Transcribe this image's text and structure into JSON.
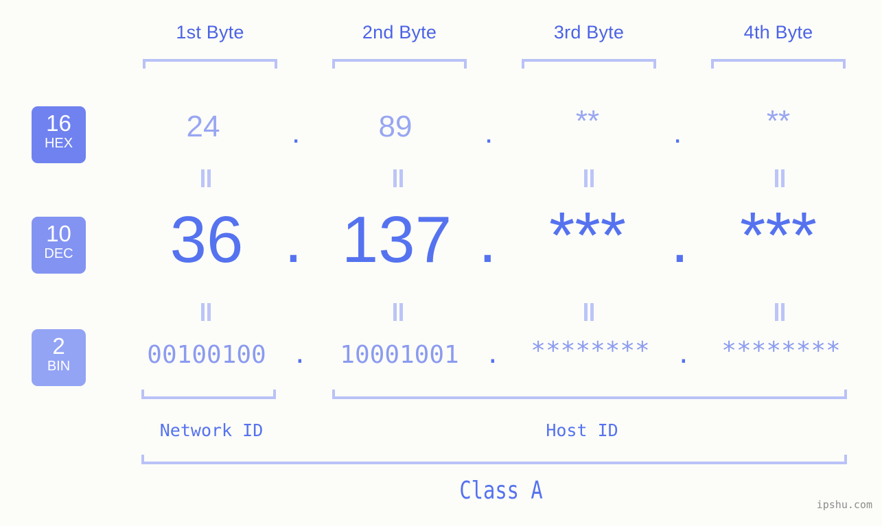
{
  "meta": {
    "background_color": "#fcfdf8",
    "accent_color": "#5572ef",
    "light_accent_color": "#b9c2f7",
    "muted_value_color": "#98a6f2"
  },
  "header": {
    "bytes": [
      {
        "label": "1st Byte"
      },
      {
        "label": "2nd Byte"
      },
      {
        "label": "3rd Byte"
      },
      {
        "label": "4th Byte"
      }
    ]
  },
  "bases": [
    {
      "number": "16",
      "name": "HEX",
      "color": "#6f82ef"
    },
    {
      "number": "10",
      "name": "DEC",
      "color": "#8293f2"
    },
    {
      "number": "2",
      "name": "BIN",
      "color": "#93a4f5"
    }
  ],
  "rows": {
    "hex": {
      "base_number": "16",
      "base_name": "HEX",
      "values": [
        "24",
        "89",
        "**",
        "**"
      ],
      "separator": "."
    },
    "dec": {
      "base_number": "10",
      "base_name": "DEC",
      "values": [
        "36",
        "137",
        "***",
        "***"
      ],
      "separator": "."
    },
    "bin": {
      "base_number": "2",
      "base_name": "BIN",
      "values": [
        "00100100",
        "10001001",
        "********",
        "********"
      ],
      "separator": "."
    }
  },
  "equals_marks": {
    "glyph": "=",
    "count_per_row": 4
  },
  "footer": {
    "network_id_label": "Network ID",
    "host_id_label": "Host ID",
    "class_label": "Class A",
    "watermark": "ipshu.com"
  }
}
